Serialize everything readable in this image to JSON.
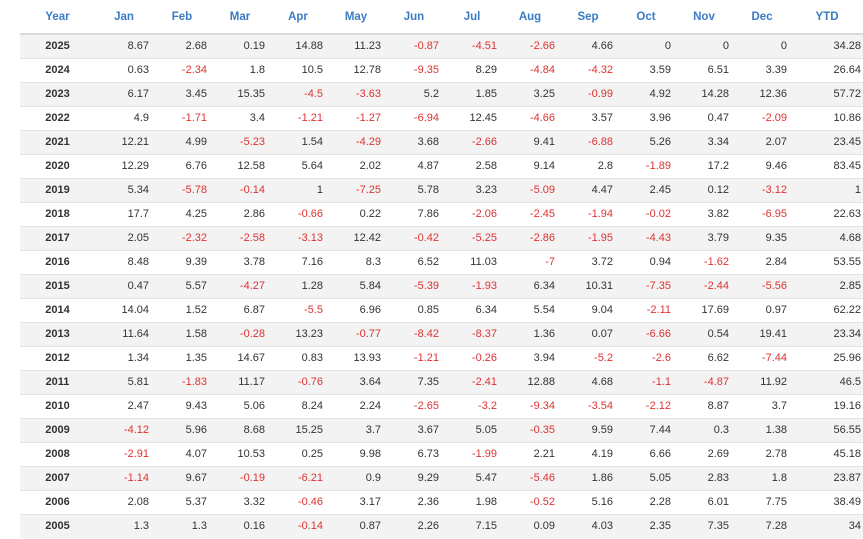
{
  "table": {
    "headers": [
      "Year",
      "Jan",
      "Feb",
      "Mar",
      "Apr",
      "May",
      "Jun",
      "Jul",
      "Aug",
      "Sep",
      "Oct",
      "Nov",
      "Dec",
      "YTD"
    ],
    "rows": [
      {
        "year": "2025",
        "values": [
          "8.67",
          "2.68",
          "0.19",
          "14.88",
          "11.23",
          "-0.87",
          "-4.51",
          "-2.66",
          "4.66",
          "0",
          "0",
          "0",
          "34.28"
        ]
      },
      {
        "year": "2024",
        "values": [
          "0.63",
          "-2.34",
          "1.8",
          "10.5",
          "12.78",
          "-9.35",
          "8.29",
          "-4.84",
          "-4.32",
          "3.59",
          "6.51",
          "3.39",
          "26.64"
        ]
      },
      {
        "year": "2023",
        "values": [
          "6.17",
          "3.45",
          "15.35",
          "-4.5",
          "-3.63",
          "5.2",
          "1.85",
          "3.25",
          "-0.99",
          "4.92",
          "14.28",
          "12.36",
          "57.72"
        ]
      },
      {
        "year": "2022",
        "values": [
          "4.9",
          "-1.71",
          "3.4",
          "-1.21",
          "-1.27",
          "-6.94",
          "12.45",
          "-4.66",
          "3.57",
          "3.96",
          "0.47",
          "-2.09",
          "10.86"
        ]
      },
      {
        "year": "2021",
        "values": [
          "12.21",
          "4.99",
          "-5.23",
          "1.54",
          "-4.29",
          "3.68",
          "-2.66",
          "9.41",
          "-6.88",
          "5.26",
          "3.34",
          "2.07",
          "23.45"
        ]
      },
      {
        "year": "2020",
        "values": [
          "12.29",
          "6.76",
          "12.58",
          "5.64",
          "2.02",
          "4.87",
          "2.58",
          "9.14",
          "2.8",
          "-1.89",
          "17.2",
          "9.46",
          "83.45"
        ]
      },
      {
        "year": "2019",
        "values": [
          "5.34",
          "-5.78",
          "-0.14",
          "1",
          "-7.25",
          "5.78",
          "3.23",
          "-5.09",
          "4.47",
          "2.45",
          "0.12",
          "-3.12",
          "1"
        ]
      },
      {
        "year": "2018",
        "values": [
          "17.7",
          "4.25",
          "2.86",
          "-0.66",
          "0.22",
          "7.86",
          "-2.06",
          "-2.45",
          "-1.94",
          "-0.02",
          "3.82",
          "-6.95",
          "22.63"
        ]
      },
      {
        "year": "2017",
        "values": [
          "2.05",
          "-2.32",
          "-2.58",
          "-3.13",
          "12.42",
          "-0.42",
          "-5.25",
          "-2.86",
          "-1.95",
          "-4.43",
          "3.79",
          "9.35",
          "4.68"
        ]
      },
      {
        "year": "2016",
        "values": [
          "8.48",
          "9.39",
          "3.78",
          "7.16",
          "8.3",
          "6.52",
          "11.03",
          "-7",
          "3.72",
          "0.94",
          "-1.62",
          "2.84",
          "53.55"
        ]
      },
      {
        "year": "2015",
        "values": [
          "0.47",
          "5.57",
          "-4.27",
          "1.28",
          "5.84",
          "-5.39",
          "-1.93",
          "6.34",
          "10.31",
          "-7.35",
          "-2.44",
          "-5.56",
          "2.85"
        ]
      },
      {
        "year": "2014",
        "values": [
          "14.04",
          "1.52",
          "6.87",
          "-5.5",
          "6.96",
          "0.85",
          "6.34",
          "5.54",
          "9.04",
          "-2.11",
          "17.69",
          "0.97",
          "62.22"
        ]
      },
      {
        "year": "2013",
        "values": [
          "11.64",
          "1.58",
          "-0.28",
          "13.23",
          "-0.77",
          "-8.42",
          "-8.37",
          "1.36",
          "0.07",
          "-6.66",
          "0.54",
          "19.41",
          "23.34"
        ]
      },
      {
        "year": "2012",
        "values": [
          "1.34",
          "1.35",
          "14.67",
          "0.83",
          "13.93",
          "-1.21",
          "-0.26",
          "3.94",
          "-5.2",
          "-2.6",
          "6.62",
          "-7.44",
          "25.96"
        ]
      },
      {
        "year": "2011",
        "values": [
          "5.81",
          "-1.83",
          "11.17",
          "-0.76",
          "3.64",
          "7.35",
          "-2.41",
          "12.88",
          "4.68",
          "-1.1",
          "-4.87",
          "11.92",
          "46.5"
        ]
      },
      {
        "year": "2010",
        "values": [
          "2.47",
          "9.43",
          "5.06",
          "8.24",
          "2.24",
          "-2.65",
          "-3.2",
          "-9.34",
          "-3.54",
          "-2.12",
          "8.87",
          "3.7",
          "19.16"
        ]
      },
      {
        "year": "2009",
        "values": [
          "-4.12",
          "5.96",
          "8.68",
          "15.25",
          "3.7",
          "3.67",
          "5.05",
          "-0.35",
          "9.59",
          "7.44",
          "0.3",
          "1.38",
          "56.55"
        ]
      },
      {
        "year": "2008",
        "values": [
          "-2.91",
          "4.07",
          "10.53",
          "0.25",
          "9.98",
          "6.73",
          "-1.99",
          "2.21",
          "4.19",
          "6.66",
          "2.69",
          "2.78",
          "45.18"
        ]
      },
      {
        "year": "2007",
        "values": [
          "-1.14",
          "9.67",
          "-0.19",
          "-6.21",
          "0.9",
          "9.29",
          "5.47",
          "-5.46",
          "1.86",
          "5.05",
          "2.83",
          "1.8",
          "23.87"
        ]
      },
      {
        "year": "2006",
        "values": [
          "2.08",
          "5.37",
          "3.32",
          "-0.46",
          "3.17",
          "2.36",
          "1.98",
          "-0.52",
          "5.16",
          "2.28",
          "6.01",
          "7.75",
          "38.49"
        ]
      },
      {
        "year": "2005",
        "values": [
          "1.3",
          "1.3",
          "0.16",
          "-0.14",
          "0.87",
          "2.26",
          "7.15",
          "0.09",
          "4.03",
          "2.35",
          "7.35",
          "7.28",
          "34"
        ]
      }
    ]
  },
  "colors": {
    "header_text": "#3a7cc4",
    "negative": "#e03131",
    "text": "#333333",
    "row_stripe": "#f3f3f3"
  }
}
